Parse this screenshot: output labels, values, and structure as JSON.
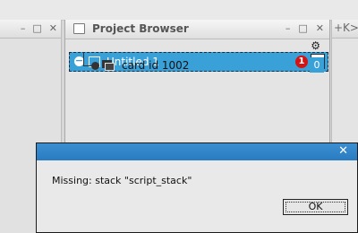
{
  "background_windows": {
    "left": {
      "minimize": "–",
      "maximize": "□",
      "close": "✕"
    },
    "right": {
      "title_fragment": "+K>"
    }
  },
  "project_browser": {
    "title": "Project Browser",
    "window_buttons": {
      "minimize": "–",
      "maximize": "□",
      "close": "✕"
    },
    "settings_icon": "gear-icon",
    "stack_row": {
      "name": "Untitled 1",
      "error_count": "1",
      "card_count": "0"
    },
    "card_row": {
      "name": "card id 1002",
      "count": "0"
    }
  },
  "dialog": {
    "close": "✕",
    "message": "Missing: stack \"script_stack\"",
    "ok_label": "OK"
  },
  "colors": {
    "selection": "#3aa0d8",
    "dialog_titlebar": "#2a7bc2",
    "error_badge": "#d21414"
  }
}
